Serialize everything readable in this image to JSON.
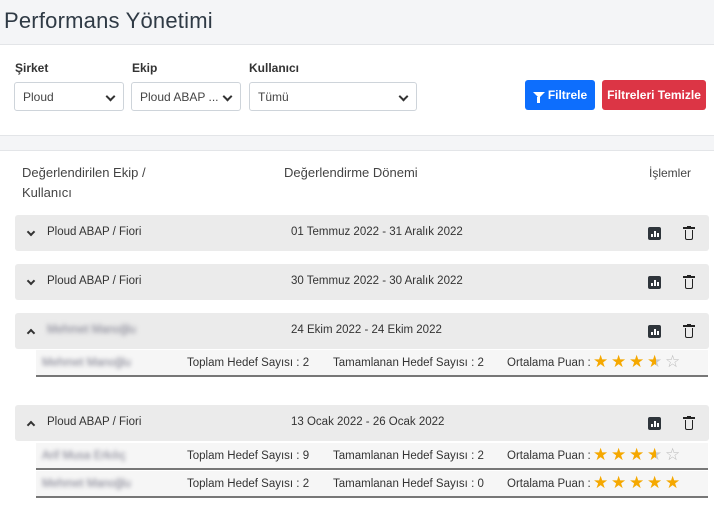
{
  "page": {
    "title": "Performans Yönetimi"
  },
  "filters": {
    "company": {
      "label": "Şirket",
      "value": "Ploud"
    },
    "team": {
      "label": "Ekip",
      "value": "Ploud ABAP ..."
    },
    "user": {
      "label": "Kullanıcı",
      "value": "Tümü"
    },
    "filter_button": "Filtrele",
    "clear_button": "Filtreleri Temizle"
  },
  "colors": {
    "primary": "#0d6efd",
    "danger": "#dc3545",
    "star": "#f5a800"
  },
  "table": {
    "headers": {
      "evaluated": "Değerlendirilen Ekip / Kullanıcı",
      "period": "Değerlendirme Dönemi",
      "actions": "İşlemler"
    },
    "groups": [
      {
        "name": "Ploud ABAP / Fiori",
        "period": "01 Temmuz 2022 - 31 Aralık 2022",
        "expanded": false,
        "blurred": false
      },
      {
        "name": "Ploud ABAP / Fiori",
        "period": "30 Temmuz 2022 - 30 Aralık 2022",
        "expanded": false,
        "blurred": false
      },
      {
        "name": "Mehmet Manoğlu",
        "period": "24 Ekim 2022 - 24 Ekim 2022",
        "expanded": true,
        "blurred": true,
        "details": [
          {
            "name": "Mehmet Manoğlu",
            "blurred": true,
            "total": "Toplam Hedef Sayısı : 2",
            "completed": "Tamamlanan Hedef Sayısı : 2",
            "avg_label": "Ortalama Puan :",
            "rating": 3.5
          }
        ]
      },
      {
        "name": "Ploud ABAP / Fiori",
        "period": "13 Ocak 2022 - 26 Ocak 2022",
        "expanded": true,
        "blurred": false,
        "details": [
          {
            "name": "Arif Musa Erkılıç",
            "blurred": true,
            "total": "Toplam Hedef Sayısı : 9",
            "completed": "Tamamlanan Hedef Sayısı : 2",
            "avg_label": "Ortalama Puan :",
            "rating": 3.5
          },
          {
            "name": "Mehmet Manoğlu",
            "blurred": true,
            "total": "Toplam Hedef Sayısı : 2",
            "completed": "Tamamlanan Hedef Sayısı : 0",
            "avg_label": "Ortalama Puan :",
            "rating": 5
          }
        ]
      }
    ],
    "icons": {
      "stats": "bar-chart-icon",
      "delete": "trash-icon"
    }
  }
}
